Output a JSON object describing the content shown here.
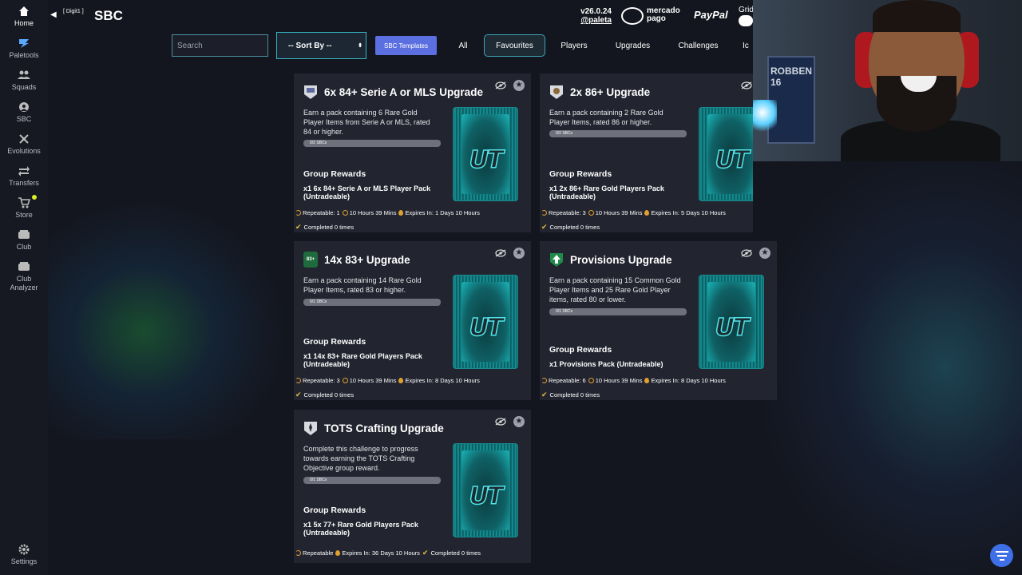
{
  "sidebar": {
    "items": [
      {
        "label": "Home"
      },
      {
        "label": "Paletools"
      },
      {
        "label": "Squads"
      },
      {
        "label": "SBC"
      },
      {
        "label": "Evolutions"
      },
      {
        "label": "Transfers"
      },
      {
        "label": "Store"
      },
      {
        "label": "Club"
      },
      {
        "label": "Club Analyzer"
      },
      {
        "label": "Settings"
      }
    ]
  },
  "header": {
    "back_tag": "[ Digit1 ]",
    "title": "SBC",
    "version": "v26.0.24",
    "handle": "@paleta",
    "mercado_pago_line1": "mercado",
    "mercado_pago_line2": "pago",
    "paypal": "PayPal",
    "grid_label": "Grid"
  },
  "filters": {
    "search_placeholder": "Search",
    "sort_label": "-- Sort By --",
    "sbc_templates": "SBC Templates",
    "tabs": [
      "All",
      "Favourites",
      "Players",
      "Upgrades",
      "Challenges",
      "Ic"
    ]
  },
  "cards": [
    {
      "title": "6x 84+ Serie A or MLS Upgrade",
      "description": "Earn a pack containing 6 Rare Gold Player Items from Serie A or MLS, rated 84 or higher.",
      "progress_label": "0/2 SBCs",
      "rewards_label": "Group Rewards",
      "reward": "x1 6x 84+ Serie A or MLS Player Pack (Untradeable)",
      "repeatable": "Repeatable: 1",
      "time": "10 Hours 39 Mins",
      "expires": "Expires In: 1 Days 10 Hours",
      "completed": "Completed 0 times"
    },
    {
      "title": "2x 86+ Upgrade",
      "description": "Earn a pack containing 2 Rare Gold Player Items, rated 86 or higher.",
      "progress_label": "0/2 SBCs",
      "rewards_label": "Group Rewards",
      "reward": "x1 2x 86+ Rare Gold Players Pack (Untradeable)",
      "repeatable": "Repeatable: 3",
      "time": "10 Hours 39 Mins",
      "expires": "Expires In: 5 Days 10 Hours",
      "completed": "Completed 0 times"
    },
    {
      "title": "14x 83+ Upgrade",
      "badge": "83+",
      "description": "Earn a pack containing 14 Rare Gold Player Items, rated 83 or higher.",
      "progress_label": "0/1 SBCs",
      "rewards_label": "Group Rewards",
      "reward": "x1 14x 83+ Rare Gold Players Pack (Untradeable)",
      "repeatable": "Repeatable: 3",
      "time": "10 Hours 39 Mins",
      "expires": "Expires In: 8 Days 10 Hours",
      "completed": "Completed 0 times"
    },
    {
      "title": "Provisions Upgrade",
      "description": "Earn a pack containing 15 Common Gold Player Items and 25 Rare Gold Player items, rated 80 or lower.",
      "progress_label": "0/1 SBCs",
      "rewards_label": "Group Rewards",
      "reward": "x1 Provisions Pack (Untradeable)",
      "repeatable": "Repeatable: 6",
      "time": "10 Hours 39 Mins",
      "expires": "Expires In: 8 Days 10 Hours",
      "completed": "Completed 0 times"
    },
    {
      "title": "TOTS Crafting Upgrade",
      "description": "Complete this challenge to progress towards earning the TOTS Crafting Objective group reward.",
      "progress_label": "0/1 SBCs",
      "rewards_label": "Group Rewards",
      "reward": "x1 5x 77+ Rare Gold Players Pack (Untradeable)",
      "repeatable": "Repeatable",
      "expires": "Expires In: 36 Days 10 Hours",
      "completed": "Completed 0 times"
    }
  ],
  "pack_logo": "UT",
  "webcam": {
    "jersey_text": "ROBBEN 16"
  },
  "colors": {
    "accent": "#5b6fe0",
    "teal": "#35b5c5",
    "card_bg": "#22242f",
    "background": "#14161f",
    "gold": "#e0a030",
    "notification": "#d8f02a"
  }
}
